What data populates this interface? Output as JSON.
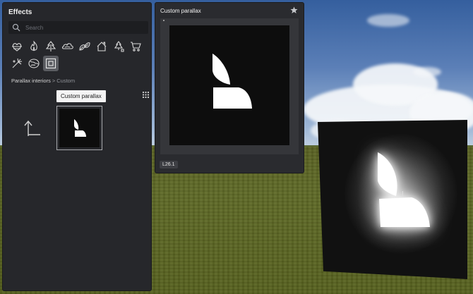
{
  "effects_panel": {
    "title": "Effects",
    "search": {
      "placeholder": "Search",
      "value": ""
    },
    "categories": [
      {
        "icon": "heart-map-icon"
      },
      {
        "icon": "flame-icon"
      },
      {
        "icon": "tree-icon"
      },
      {
        "icon": "cloud-icon"
      },
      {
        "icon": "leaves-icon"
      },
      {
        "icon": "house-icon"
      },
      {
        "icon": "christmas-tree-icon"
      },
      {
        "icon": "shopping-cart-icon"
      },
      {
        "icon": "fireworks-icon"
      },
      {
        "icon": "globe-icon"
      },
      {
        "icon": "parallax-square-icon",
        "selected": true
      }
    ],
    "breadcrumb": {
      "parent": "Parallax interiors",
      "separator": ">",
      "current": "Custom"
    },
    "tooltip": "Custom parallax"
  },
  "parallax_panel": {
    "title": "Custom parallax",
    "version": "L26.1"
  },
  "colors": {
    "panel_bg": "#26272b",
    "preview_bg": "#0d0d0d",
    "logo": "#ffffff",
    "selected_bg": "#5a5c61"
  }
}
